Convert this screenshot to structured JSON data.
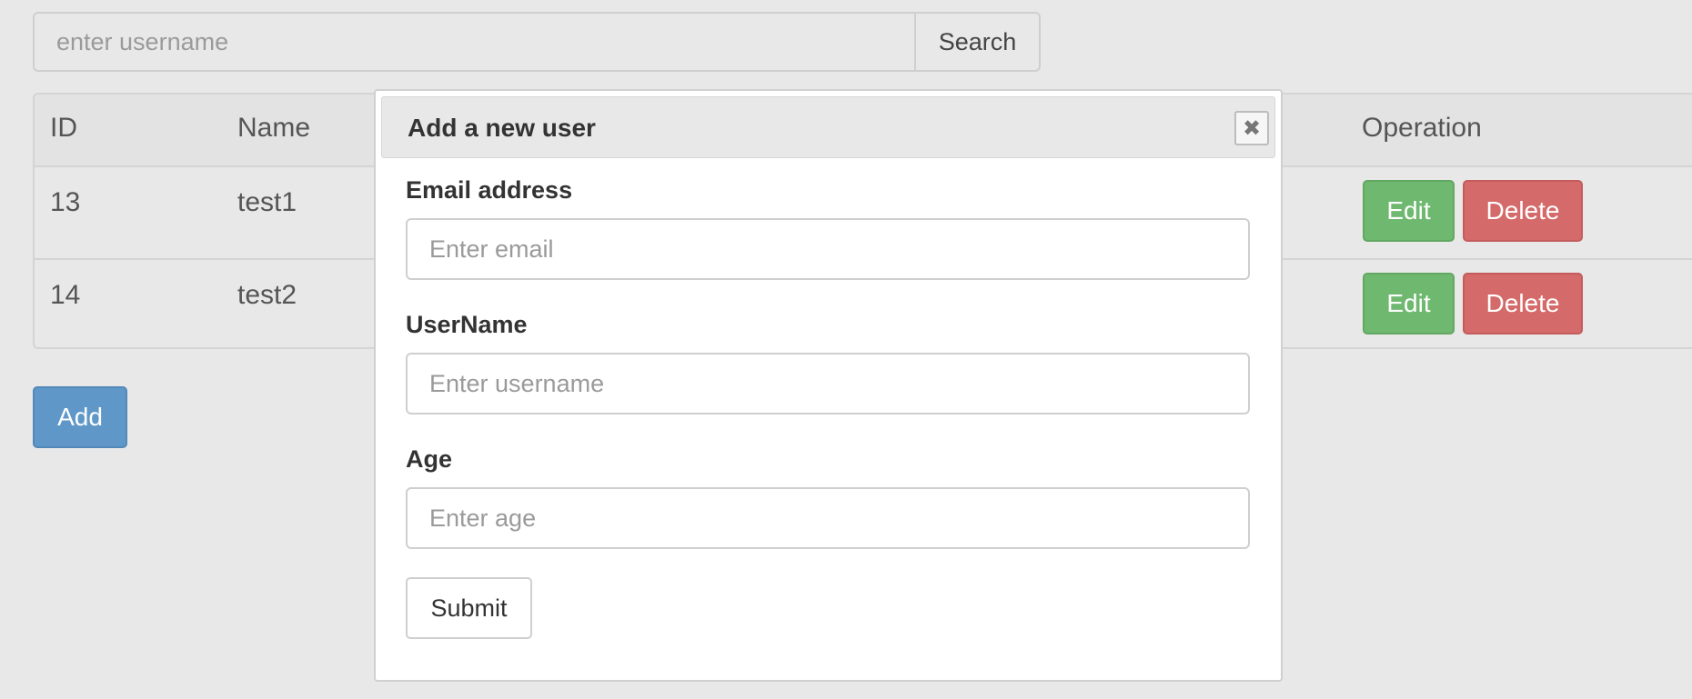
{
  "search": {
    "placeholder": "enter username",
    "button_label": "Search"
  },
  "table": {
    "headers": {
      "id": "ID",
      "name": "Name",
      "operation": "Operation"
    },
    "rows": [
      {
        "id": "13",
        "name": "test1"
      },
      {
        "id": "14",
        "name": "test2"
      }
    ],
    "edit_label": "Edit",
    "delete_label": "Delete"
  },
  "add_button_label": "Add",
  "modal": {
    "title": "Add a new user",
    "close_glyph": "✖",
    "fields": {
      "email": {
        "label": "Email address",
        "placeholder": "Enter email"
      },
      "username": {
        "label": "UserName",
        "placeholder": "Enter username"
      },
      "age": {
        "label": "Age",
        "placeholder": "Enter age"
      }
    },
    "submit_label": "Submit"
  },
  "colors": {
    "edit": "#6fb86f",
    "delete": "#d46a6a",
    "add": "#5f98c8",
    "background": "#e8e8e8"
  }
}
